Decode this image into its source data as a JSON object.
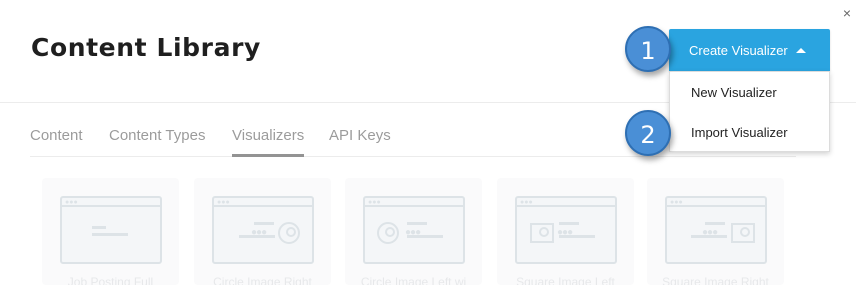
{
  "header": {
    "title": "Content Library",
    "close_label": "×"
  },
  "tabs": [
    {
      "label": "Content",
      "active": false
    },
    {
      "label": "Content Types",
      "active": false
    },
    {
      "label": "Visualizers",
      "active": true
    },
    {
      "label": "API Keys",
      "active": false
    }
  ],
  "create_button": {
    "label": "Create Visualizer",
    "icon": "caret-up-icon"
  },
  "dropdown": {
    "items": [
      {
        "label": "New Visualizer"
      },
      {
        "label": "Import Visualizer"
      }
    ]
  },
  "callouts": [
    {
      "number": "1"
    },
    {
      "number": "2"
    }
  ],
  "cards": [
    {
      "caption": "Job Posting Full"
    },
    {
      "caption": "Circle Image Right"
    },
    {
      "caption": "Circle Image Left wi"
    },
    {
      "caption": "Square Image Left"
    },
    {
      "caption": "Square Image Right"
    }
  ],
  "colors": {
    "accent": "#2aa4e0",
    "callout": "#4a8fd6"
  }
}
